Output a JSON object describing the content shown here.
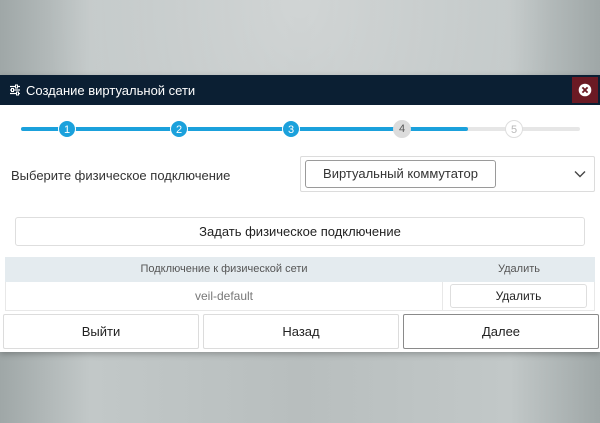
{
  "dialog": {
    "title": "Создание виртуальной сети",
    "title_icon": "sliders-icon",
    "close_icon": "close-icon"
  },
  "stepper": {
    "steps": [
      {
        "label": "1",
        "state": "done"
      },
      {
        "label": "2",
        "state": "done"
      },
      {
        "label": "3",
        "state": "done"
      },
      {
        "label": "4",
        "state": "active"
      },
      {
        "label": "5",
        "state": "todo"
      }
    ],
    "progress_fraction": 0.8,
    "accent_color": "#1ba1dc"
  },
  "physical": {
    "label": "Выберите физическое подключение",
    "selected_value": "Виртуальный коммутатор"
  },
  "set_button": "Задать физическое подключение",
  "table": {
    "columns": [
      "Подключение к физической сети",
      "Удалить"
    ],
    "rows": [
      {
        "name": "veil-default",
        "action": "Удалить"
      }
    ]
  },
  "footer": {
    "exit": "Выйти",
    "back": "Назад",
    "next": "Далее"
  },
  "colors": {
    "titlebar": "#0b1f33",
    "close_button": "#6b1a24",
    "table_header": "#e4ebef"
  }
}
